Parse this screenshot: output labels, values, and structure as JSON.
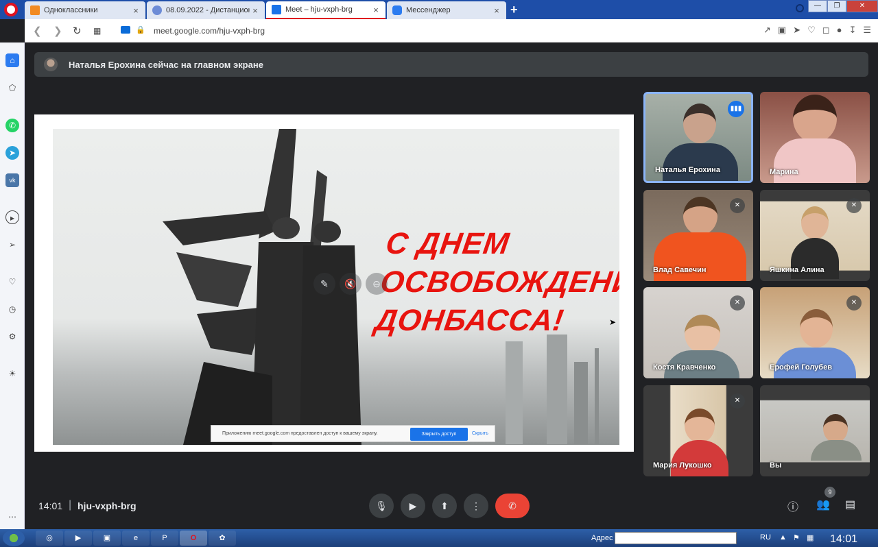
{
  "browser": {
    "tabs": [
      {
        "label": "Одноклассники",
        "icon_color": "#f28a22",
        "active": false
      },
      {
        "label": "08.09.2022 - Дистанционн",
        "icon_color": "#6c8bd6",
        "active": false
      },
      {
        "label": "Meet – hju-vxph-brg",
        "icon_color": "#1a73e8",
        "active": true
      },
      {
        "label": "Мессенджер",
        "icon_color": "#2b7bf0",
        "active": false
      }
    ],
    "new_tab_label": "+",
    "url": "meet.google.com/hju-vxph-brg"
  },
  "meet": {
    "presenter_banner": "Наталья Ерохина сейчас на главном экране",
    "slide": {
      "headline": [
        "С ДНЕМ",
        "ОСВОБОЖДЕНИЯ",
        "ДОНБАССА!"
      ],
      "share_notice": "Приложению meet.google.com предоставлен доступ к вашему экрану.",
      "stop_sharing_label": "Закрыть доступ",
      "hide_label": "Скрыть"
    },
    "participants": [
      {
        "name": "Наталья Ерохина",
        "state": "speaking"
      },
      {
        "name": "Марина",
        "state": "none"
      },
      {
        "name": "Влад Савечин",
        "state": "muted"
      },
      {
        "name": "Яшкина Алина",
        "state": "muted"
      },
      {
        "name": "Костя Кравченко",
        "state": "muted"
      },
      {
        "name": "Ерофей Голубев",
        "state": "muted"
      },
      {
        "name": "Мария Лукошко",
        "state": "muted"
      },
      {
        "name": "Вы",
        "state": "none"
      }
    ],
    "time": "14:01",
    "meeting_code": "hju-vxph-brg",
    "participants_count": "9",
    "accent_color": "#8ab4f8",
    "end_call_color": "#ea4335"
  },
  "taskbar": {
    "address_label": "Адрес",
    "language": "RU",
    "clock": "14:01"
  }
}
